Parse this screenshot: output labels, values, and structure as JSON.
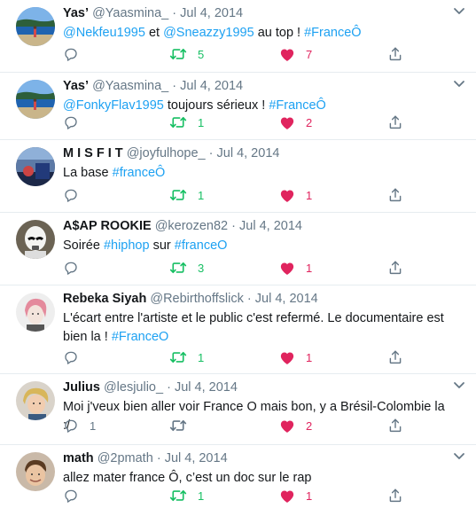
{
  "tweets": [
    {
      "name": "Yas’",
      "handle": "@Yaasmina_",
      "dot": "·",
      "date": "Jul 4, 2014",
      "text": [
        {
          "t": "@Nekfeu1995",
          "link": true
        },
        {
          "t": " et ",
          "link": false
        },
        {
          "t": "@Sneazzy1995",
          "link": true
        },
        {
          "t": " au top ! ",
          "link": false
        },
        {
          "t": "#FranceÔ",
          "link": true
        }
      ],
      "replies": "",
      "retweets": "5",
      "likes": "7",
      "avatar": "beach"
    },
    {
      "name": "Yas’",
      "handle": "@Yaasmina_",
      "dot": "·",
      "date": "Jul 4, 2014",
      "text": [
        {
          "t": "@FonkyFlav1995",
          "link": true
        },
        {
          "t": " toujours sérieux ! ",
          "link": false
        },
        {
          "t": "#FranceÔ",
          "link": true
        }
      ],
      "replies": "",
      "retweets": "1",
      "likes": "2",
      "avatar": "beach"
    },
    {
      "name": "M I S F I T",
      "handle": "@joyfulhope_",
      "dot": "·",
      "date": "Jul 4, 2014",
      "text": [
        {
          "t": "La base ",
          "link": false
        },
        {
          "t": "#franceÔ",
          "link": true
        }
      ],
      "replies": "",
      "retweets": "1",
      "likes": "1",
      "avatar": "stadium"
    },
    {
      "name": "A$AP ROOKIE",
      "handle": "@kerozen82",
      "dot": "·",
      "date": "Jul 4, 2014",
      "text": [
        {
          "t": "Soirée ",
          "link": false
        },
        {
          "t": "#hiphop",
          "link": true
        },
        {
          "t": " sur ",
          "link": false
        },
        {
          "t": "#franceO",
          "link": true
        }
      ],
      "replies": "",
      "retweets": "3",
      "likes": "1",
      "avatar": "trooper"
    },
    {
      "name": "Rebeka Siyah",
      "handle": "@Rebirthoffslick",
      "dot": "·",
      "date": "Jul 4, 2014",
      "text": [
        {
          "t": "L'écart entre l'artiste et le public c'est refermé. Le documentaire est bien la ! ",
          "link": false
        },
        {
          "t": "#FranceO",
          "link": true
        }
      ],
      "replies": "",
      "retweets": "1",
      "likes": "1",
      "avatar": "pinkhair"
    },
    {
      "name": "Julius",
      "handle": "@lesjulio_",
      "dot": "·",
      "date": "Jul 4, 2014",
      "text": [
        {
          "t": "Moi j'veux bien aller voir France O mais bon, y a Brésil-Colombie la :/",
          "link": false
        }
      ],
      "replies": "1",
      "retweets": "",
      "likes": "2",
      "avatar": "blond"
    },
    {
      "name": "math",
      "handle": "@2pmath",
      "dot": "·",
      "date": "Jul 4, 2014",
      "text": [
        {
          "t": "allez mater france Ô, c’est un doc sur le rap",
          "link": false
        }
      ],
      "replies": "",
      "retweets": "1",
      "likes": "1",
      "avatar": "face"
    }
  ],
  "colors": {
    "link": "#1da1f2",
    "retweet": "#17bf63",
    "like": "#e0245e",
    "muted": "#657786"
  }
}
